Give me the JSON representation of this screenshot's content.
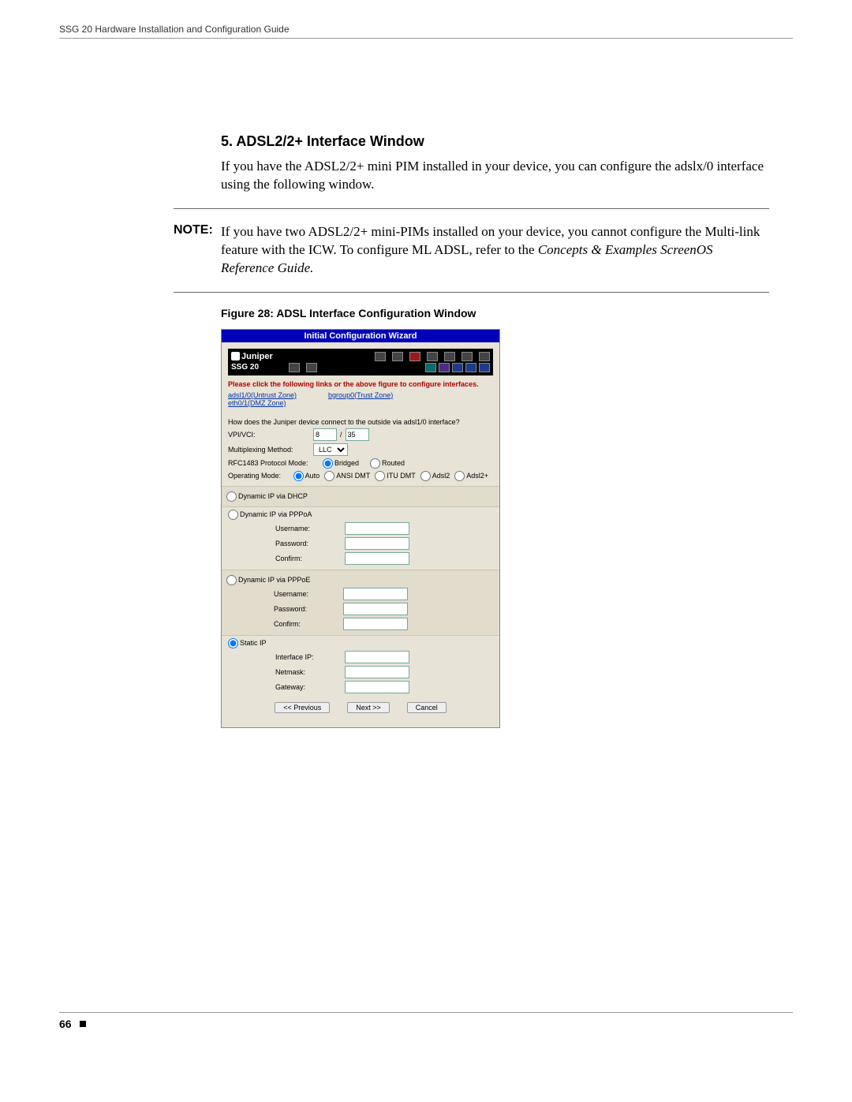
{
  "header": "SSG 20 Hardware Installation and Configuration Guide",
  "section": {
    "title": "5. ADSL2/2+ Interface Window",
    "para": "If you have the ADSL2/2+ mini PIM installed in your device, you can configure the adslx/0 interface using the following window."
  },
  "note": {
    "label": "NOTE:",
    "body_1": "If you have two ADSL2/2+ mini-PIMs installed on your device, you cannot configure the Multi-link feature with the ICW. To configure ML ADSL, refer to the ",
    "body_em": "Concepts & Examples ScreenOS Reference Guide.",
    "body_2": ""
  },
  "figure_caption": "Figure 28:  ADSL Interface Configuration Window",
  "wizard": {
    "title": "Initial Configuration Wizard",
    "brand": "Juniper",
    "device": "SSG 20",
    "instruction": "Please click the following links or the above figure to configure interfaces.",
    "links": {
      "l1": "adsl1/0(Untrust Zone)",
      "l2": "bgroup0(Trust Zone)",
      "l3": "eth0/1(DMZ Zone)"
    },
    "question": "How does the Juniper device connect to the outside via adsl1/0 interface?",
    "fields": {
      "vpi_label": "VPI/VCI:",
      "vpi_val": "8",
      "vpi_sep": "/",
      "vci_val": "35",
      "mux_label": "Multiplexing Method:",
      "mux_val": "LLC",
      "rfc_label": "RFC1483 Protocol Mode:",
      "rfc_opt1": "Bridged",
      "rfc_opt2": "Routed",
      "op_label": "Operating Mode:",
      "op_opts": {
        "o1": "Auto",
        "o2": "ANSI DMT",
        "o3": "ITU DMT",
        "o4": "Adsl2",
        "o5": "Adsl2+"
      }
    },
    "ip_modes": {
      "dhcp": "Dynamic IP via DHCP",
      "pppoa": "Dynamic IP via PPPoA",
      "pppoe": "Dynamic IP via PPPoE",
      "static": "Static IP",
      "username": "Username:",
      "password": "Password:",
      "confirm": "Confirm:",
      "iface_ip": "Interface IP:",
      "netmask": "Netmask:",
      "gateway": "Gateway:"
    },
    "buttons": {
      "prev": "<< Previous",
      "next": "Next >>",
      "cancel": "Cancel"
    }
  },
  "footer": {
    "page": "66"
  }
}
